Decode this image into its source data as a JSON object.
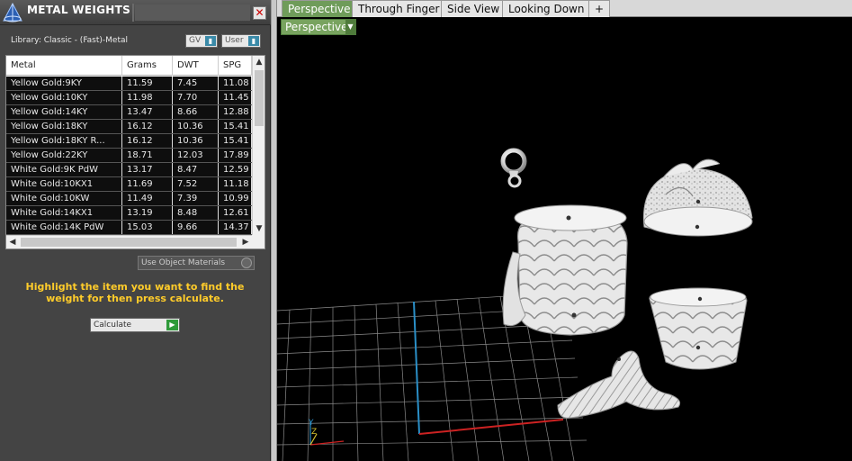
{
  "panel": {
    "title": "METAL WEIGHTS",
    "close_label": "✕",
    "library_label": "Library: Classic - (Fast)-Metal",
    "gv_label": "GV",
    "user_label": "User"
  },
  "table": {
    "headers": [
      "Metal",
      "Grams",
      "DWT",
      "SPG"
    ],
    "rows": [
      [
        "Yellow Gold:9KY",
        "11.59",
        "7.45",
        "11.08"
      ],
      [
        "Yellow Gold:10KY",
        "11.98",
        "7.70",
        "11.45"
      ],
      [
        "Yellow Gold:14KY",
        "13.47",
        "8.66",
        "12.88"
      ],
      [
        "Yellow Gold:18KY",
        "16.12",
        "10.36",
        "15.41"
      ],
      [
        "Yellow Gold:18KY R...",
        "16.12",
        "10.36",
        "15.41"
      ],
      [
        "Yellow Gold:22KY",
        "18.71",
        "12.03",
        "17.89"
      ],
      [
        "White Gold:9K PdW",
        "13.17",
        "8.47",
        "12.59"
      ],
      [
        "White Gold:10KX1",
        "11.69",
        "7.52",
        "11.18"
      ],
      [
        "White Gold:10KW",
        "11.49",
        "7.39",
        "10.99"
      ],
      [
        "White Gold:14KX1",
        "13.19",
        "8.48",
        "12.61"
      ],
      [
        "White Gold:14K PdW",
        "15.03",
        "9.66",
        "14.37"
      ]
    ]
  },
  "controls": {
    "use_object_materials": "Use Object Materials",
    "instruction": "Highlight the item you want to find the weight for then press calculate.",
    "calculate_label": "Calculate"
  },
  "viewport": {
    "tabs": [
      "Perspective",
      "Through Finger",
      "Side View",
      "Looking Down"
    ],
    "add_tab": "+",
    "view_menu_label": "Perspective",
    "axis_y": "Y",
    "axis_z": "Z"
  },
  "colors": {
    "accent_tab": "#6f9c5a",
    "instruction_text": "#ffcc2a"
  }
}
